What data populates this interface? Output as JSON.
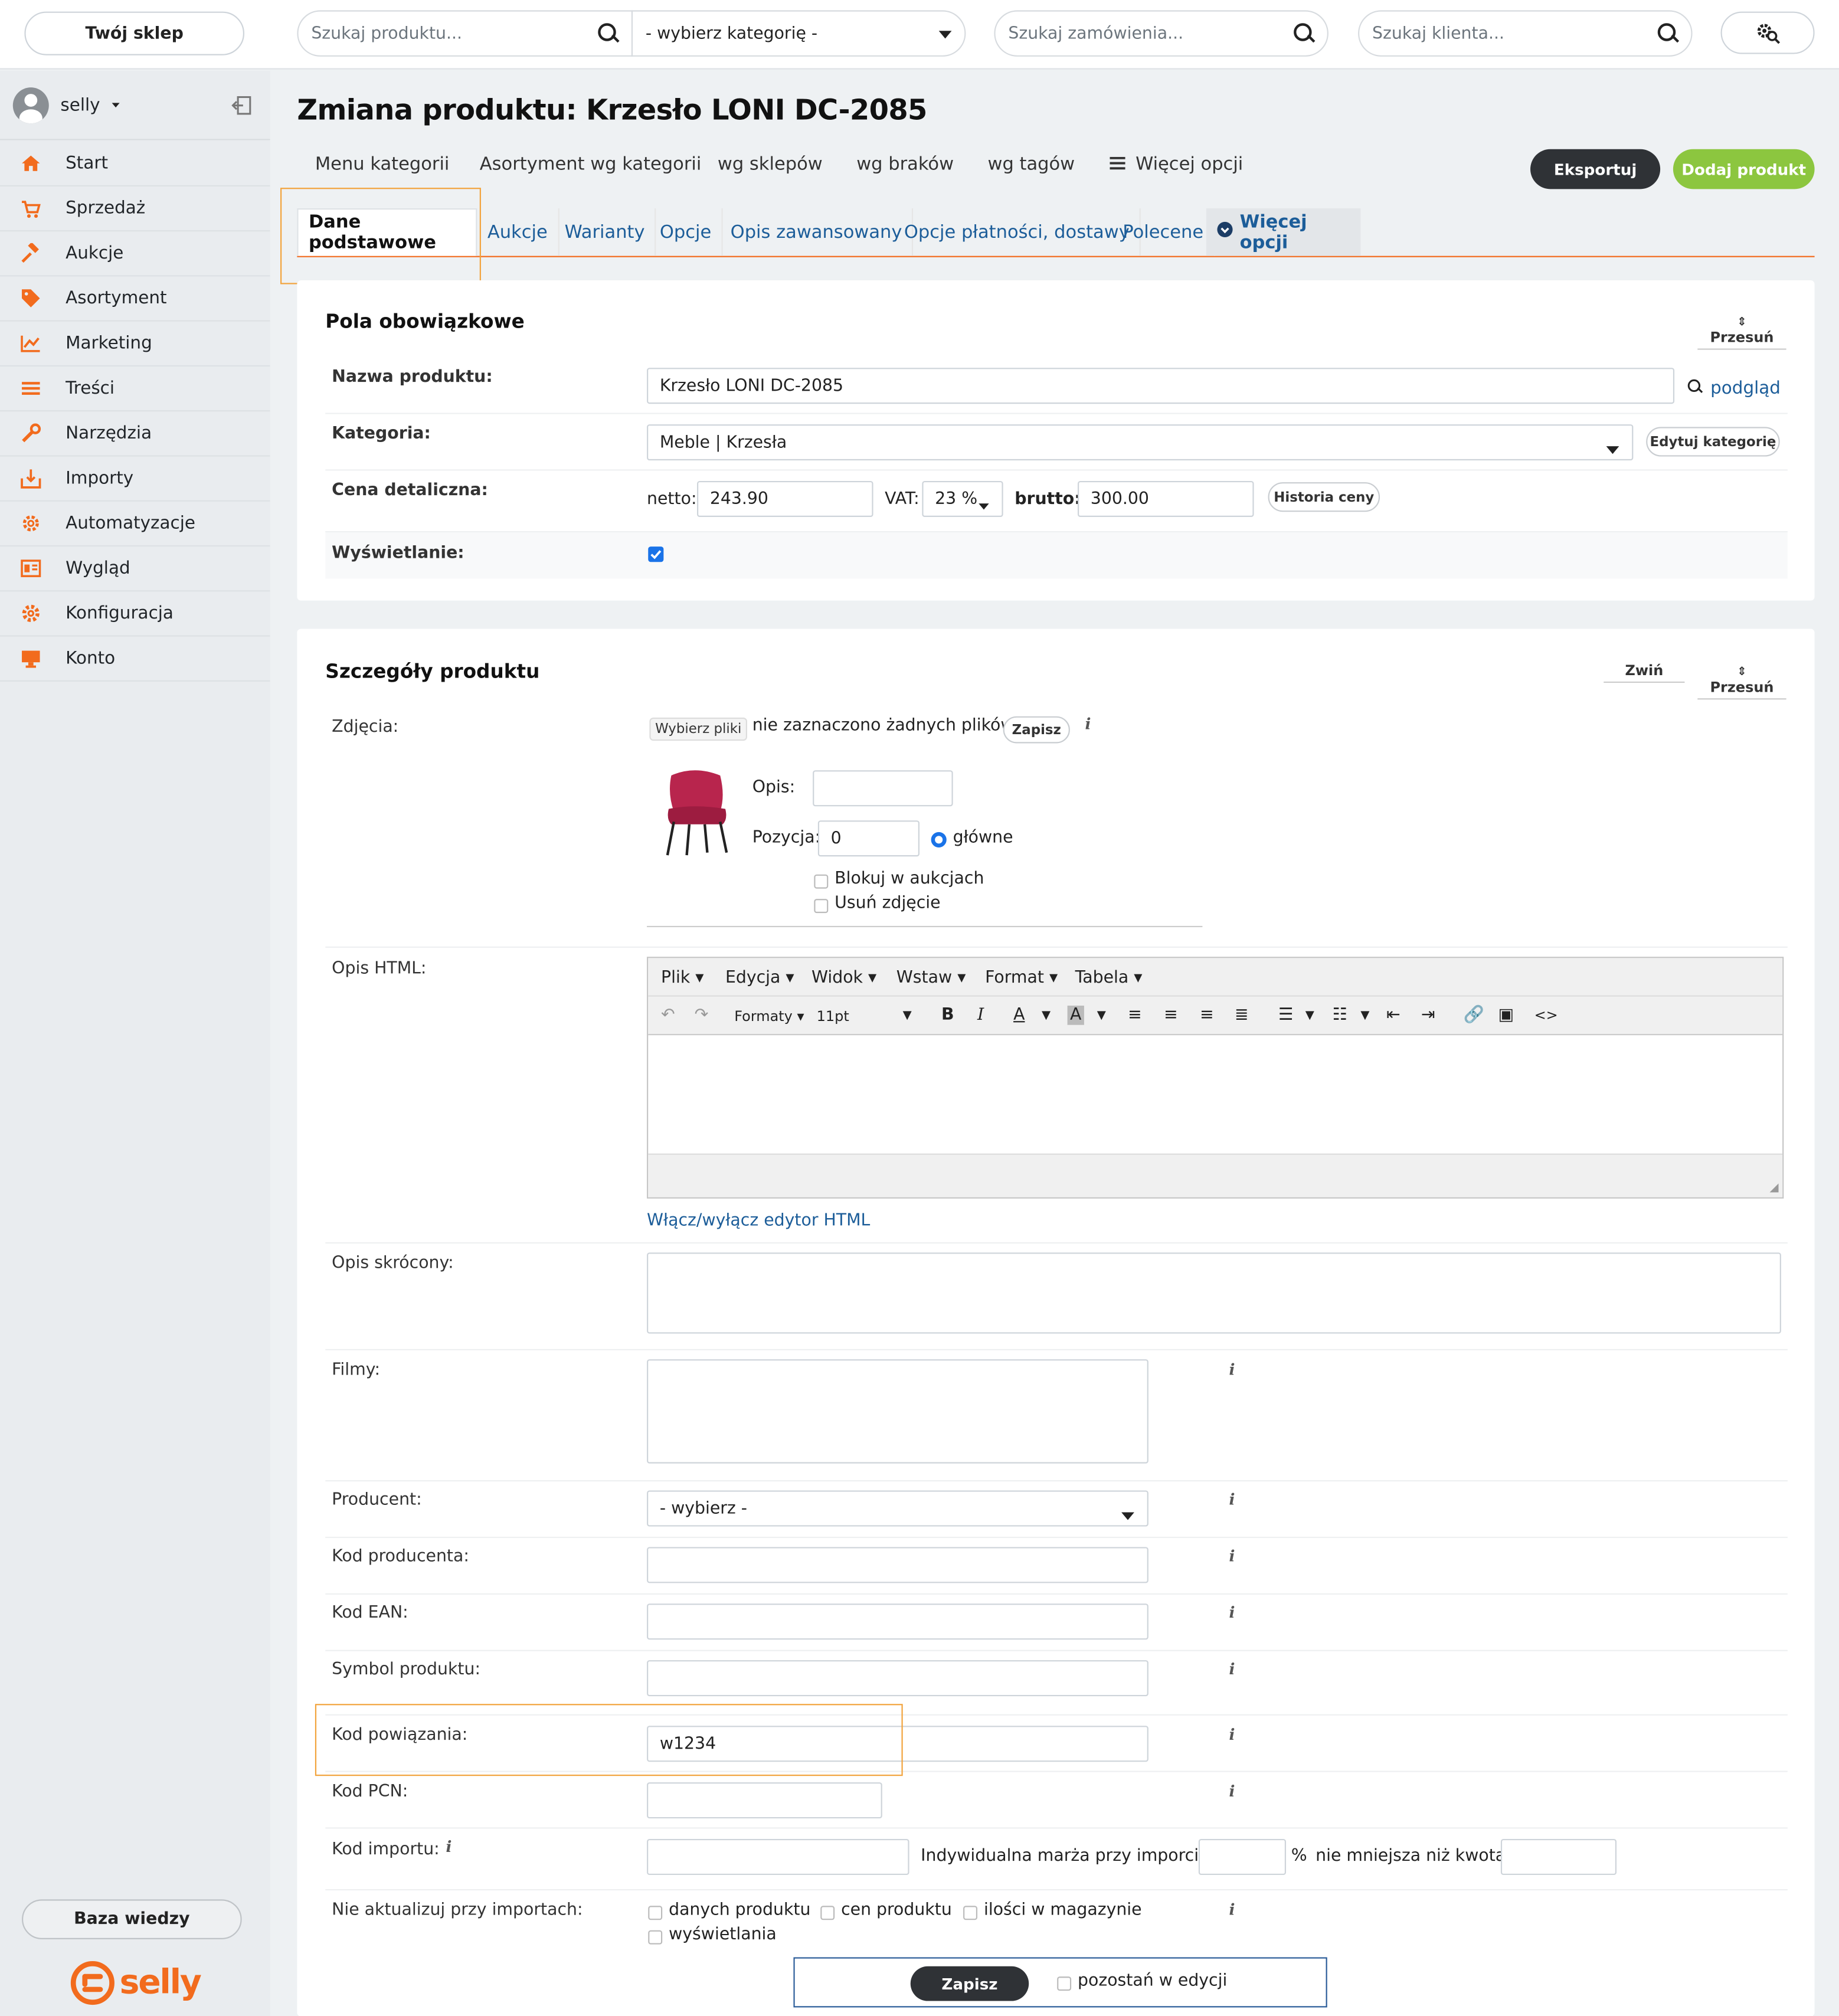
{
  "topbar": {
    "shop_button": "Twój sklep",
    "search_product_placeholder": "Szukaj produktu...",
    "category_select": "- wybierz kategorię -",
    "search_order_placeholder": "Szukaj zamówienia...",
    "search_client_placeholder": "Szukaj klienta..."
  },
  "sidebar": {
    "user": "selly",
    "items": [
      {
        "label": "Start",
        "icon": "home-icon"
      },
      {
        "label": "Sprzedaż",
        "icon": "cart-icon"
      },
      {
        "label": "Aukcje",
        "icon": "gavel-icon"
      },
      {
        "label": "Asortyment",
        "icon": "tag-icon"
      },
      {
        "label": "Marketing",
        "icon": "chart-line-icon"
      },
      {
        "label": "Treści",
        "icon": "list-icon"
      },
      {
        "label": "Narzędzia",
        "icon": "wrench-icon"
      },
      {
        "label": "Importy",
        "icon": "import-icon"
      },
      {
        "label": "Automatyzacje",
        "icon": "cog-icon"
      },
      {
        "label": "Wygląd",
        "icon": "layout-icon"
      },
      {
        "label": "Konfiguracja",
        "icon": "gear-icon"
      },
      {
        "label": "Konto",
        "icon": "monitor-icon"
      }
    ],
    "knowledge_button": "Baza wiedzy",
    "logo_text": "selly"
  },
  "header": {
    "title": "Zmiana produktu: Krzesło LONI DC-2085",
    "subnav": [
      "Menu kategorii",
      "Asortyment wg kategorii",
      "wg sklepów",
      "wg braków",
      "wg tagów",
      "Więcej opcji"
    ],
    "export_button": "Eksportuj",
    "add_product_button": "Dodaj produkt"
  },
  "tabs": [
    "Dane podstawowe",
    "Aukcje",
    "Warianty",
    "Opcje",
    "Opis zawansowany",
    "Opcje płatności, dostawy",
    "Polecene",
    "Więcej opcji"
  ],
  "required": {
    "title": "Pola obowiązkowe",
    "move": "Przesuń",
    "name_label": "Nazwa produktu:",
    "name_value": "Krzesło LONI DC-2085",
    "preview": "podgląd",
    "category_label": "Kategoria:",
    "category_value": "Meble | Krzesła",
    "edit_category": "Edytuj kategorię",
    "price_label": "Cena detaliczna:",
    "netto_label": "netto:",
    "netto_value": "243.90",
    "vat_label": "VAT:",
    "vat_value": "23 %",
    "brutto_label": "brutto:",
    "brutto_value": "300.00",
    "price_history": "Historia ceny",
    "display_label": "Wyświetlanie:"
  },
  "details": {
    "title": "Szczegóły produktu",
    "collapse": "Zwiń",
    "move": "Przesuń",
    "photos_label": "Zdjęcia:",
    "choose_files": "Wybierz pliki",
    "no_files": "nie zaznaczono żadnych plików",
    "save_small": "Zapisz",
    "opis_label": "Opis:",
    "pozycja_label": "Pozycja:",
    "pozycja_value": "0",
    "main_label": "główne",
    "block_label": "Blokuj w aukcjach",
    "delete_label": "Usuń zdjęcie",
    "html_label": "Opis HTML:",
    "editor_menu": [
      "Plik",
      "Edycja",
      "Widok",
      "Wstaw",
      "Format",
      "Tabela"
    ],
    "editor_formats": "Formaty",
    "editor_size": "11pt",
    "toggle_editor": "Włącz/wyłącz edytor HTML",
    "short_label": "Opis skrócony:",
    "films_label": "Filmy:",
    "producer_label": "Producent:",
    "producer_value": "- wybierz -",
    "producer_code_label": "Kod producenta:",
    "ean_label": "Kod EAN:",
    "symbol_label": "Symbol produktu:",
    "link_code_label": "Kod powiązania:",
    "link_code_value": "w1234",
    "pcn_label": "Kod PCN:",
    "import_label": "Kod importu:",
    "margin_label": "Indywidualna marża przy imporcie:",
    "percent": "%",
    "min_amount_label": "nie mniejsza niż kwota:",
    "no_update_label": "Nie aktualizuj przy importach:",
    "no_update_opts": [
      "danych produktu",
      "cen produktu",
      "ilości w magazynie",
      "wyświetlania"
    ]
  },
  "savebar": {
    "save": "Zapisz",
    "stay": "pozostań w edycji"
  },
  "colors": {
    "accent": "#f26b1d",
    "link": "#1c5d99",
    "green": "#8cc63f",
    "dark": "#2f3236",
    "highlight": "#f2a33c"
  }
}
